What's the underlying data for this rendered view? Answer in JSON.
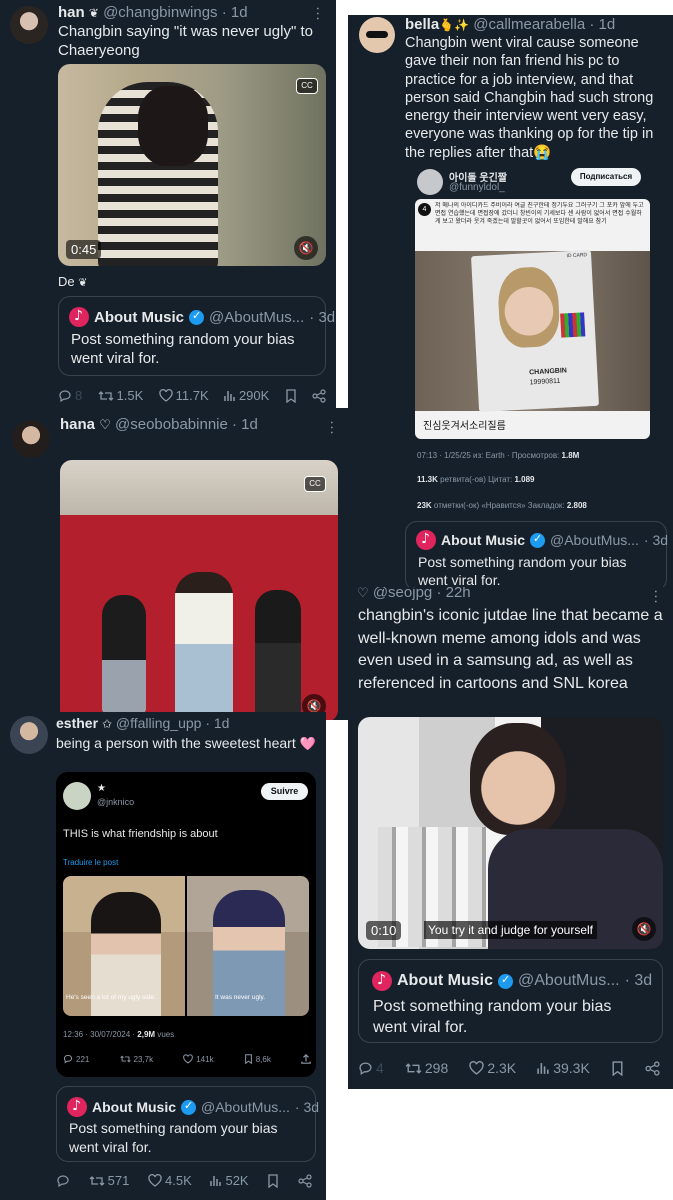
{
  "icons": {
    "mute": "🔇",
    "cc": "CC",
    "badge": "❦",
    "heart_emoji": "🩷",
    "verified": "✓"
  },
  "colors": {
    "bg": "#15202b",
    "accent": "#1d9bf0",
    "muted": "#8b98a5",
    "music": "#e0245e",
    "heart_emoji": "#ff8fb8"
  },
  "quoted": {
    "name": "About Music",
    "handle_long": "@AboutMus...",
    "handle_short": "@AboutMus...",
    "time": "· 3d",
    "text": "Post something random your bias went viral for."
  },
  "tweet1": {
    "name": "han",
    "handle": "@changbinwings",
    "time": "· 1d",
    "text": "Changbin saying \"it was never ugly\" to Chaeryeong",
    "video_time": "0:45",
    "reply_text": "De",
    "stats": {
      "replies": "8",
      "retweets": "1.5K",
      "likes": "11.7K",
      "views": "290K"
    }
  },
  "tweet2": {
    "name": "bella",
    "emoji": "🫰✨",
    "handle": "@callmearabella",
    "time": "· 1d",
    "text": "Changbin went viral cause someone gave their non fan friend his pc to practice for a job interview, and that person said Changbin had such strong energy their interview went very easy, everyone was thanking op for the tip in the replies after that😭",
    "embed": {
      "name": "아이돌 웃긴짤",
      "handle": "@funnyldol_",
      "subscribe": "Подписаться",
      "card_text": "저 메나의 아이디카드 주비이라 여글 친구한테 정기두요 그러구기 그 포카 앞에 두고 면접 연습했는데 면접장에 갔더니 창빈이의 기세보다 센 사람이 없어서 면접 수월하게 보고 왔더라 웃겨 죽겠는데 말할곳이 없어서 또임한테 말해요 참기",
      "card_number": "4",
      "photocard_name": "CHANGBIN",
      "photocard_date": "19990811",
      "photocard_tag": "ID CARD",
      "caption": "진심웃겨서소리질름",
      "meta_time": "07:13 · 1/25/25 из: Earth · Просмотров:",
      "meta_views": "1.8M",
      "retweets": "11.3K",
      "retweets_label": "ретвита(-ов)",
      "quotes_label": "Цитат:",
      "quotes": "1.089",
      "likes": "23K",
      "likes_label": "отметки(-ок) «Нравится»",
      "bookmarks_label": "Закладок:",
      "bookmarks": "2.808"
    }
  },
  "tweet3": {
    "name": "hana",
    "heart": "♡",
    "handle": "@seobobabinnie",
    "time": "· 1d"
  },
  "tweet4": {
    "heart": "♡",
    "handle": "@seojpg",
    "time": "· 22h",
    "text": "changbin's iconic jutdae line that became a well-known meme among idols and was even used in a samsung ad, as well as referenced in cartoons and SNL korea",
    "video_time": "0:10",
    "subtitle": "You try it and judge for yourself",
    "stats": {
      "replies": "4",
      "retweets": "298",
      "likes": "2.3K",
      "views": "39.3K"
    }
  },
  "tweet5": {
    "name": "esther",
    "star": "✩",
    "handle": "@ffalling_upp",
    "time": "· 1d",
    "text": "being a person with the sweetest heart",
    "embed": {
      "name": "★",
      "handle": "@jnknico",
      "follow": "Suivre",
      "text": "THIS is what friendship is about",
      "translate": "Traduire le post",
      "sub_left": "He's seen a lot of my ugly side.",
      "sub_right": "It was never ugly.",
      "meta": "12:36 · 30/07/2024 ·",
      "views": "2,9M",
      "views_label": "vues",
      "replies": "221",
      "retweets": "23,7k",
      "likes": "141k",
      "bookmarks": "8,6k"
    },
    "stats": {
      "retweets": "571",
      "likes": "4.5K",
      "views": "52K"
    }
  }
}
